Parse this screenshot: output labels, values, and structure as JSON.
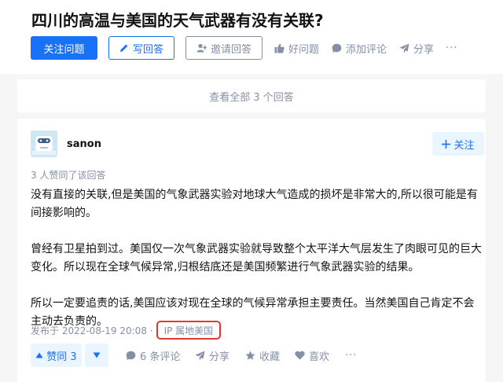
{
  "question": {
    "title": "四川的高温与美国的天气武器有没有关联?",
    "follow_label": "关注问题",
    "write_label": "写回答",
    "invite_label": "邀请回答",
    "good_label": "好问题",
    "comment_label": "添加评论",
    "share_label": "分享",
    "more_label": "···"
  },
  "view_all_label": "查看全部 3 个回答",
  "answer": {
    "author": "sanon",
    "follow_label": "关注",
    "upvote_info": "3 人赞同了该回答",
    "paragraphs": [
      "没有直接的关联,但是美国的气象武器实验对地球大气造成的损坏是非常大的,所以很可能是有间接影响的。",
      "曾经有卫星拍到过。美国仅一次气象武器实验就导致整个太平洋大气层发生了肉眼可见的巨大变化。所以现在全球气候异常,归根结底还是美国频繁进行气象武器实验的结果。",
      "所以一定要追责的话,美国应该对现在全球的气候异常承担主要责任。当然美国自己肯定不会主动去负责的。"
    ],
    "published": "发布于 2022-08-19 20:08 ·",
    "ip_location": "IP 属地美国",
    "vote_label": "赞同 3",
    "comments_label": "6 条评论",
    "share_label": "分享",
    "collect_label": "收藏",
    "like_label": "喜欢",
    "more_label": "···"
  },
  "colors": {
    "accent": "#1772f6",
    "muted": "#8590a6",
    "highlight_box": "#e03a2f"
  }
}
